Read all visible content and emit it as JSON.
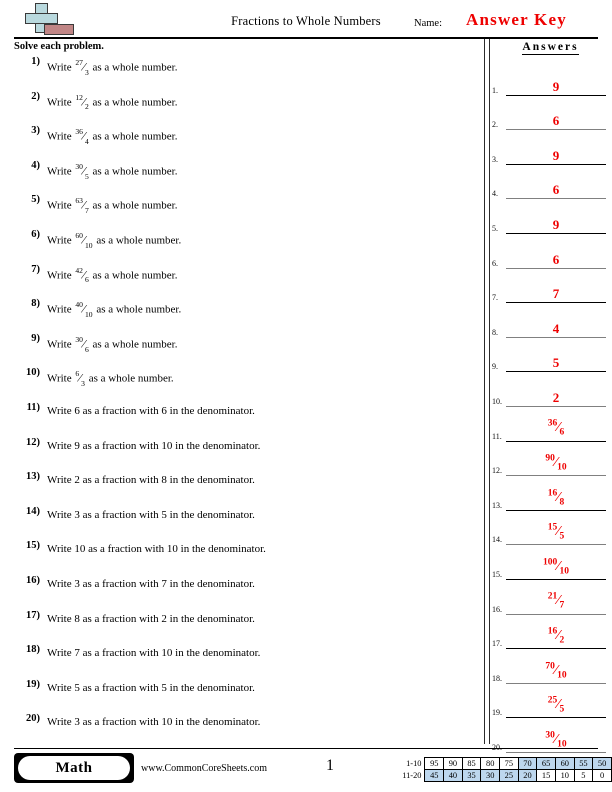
{
  "header": {
    "title": "Fractions to Whole Numbers",
    "name_label": "Name:",
    "answer_key": "Answer Key",
    "logo_icon": "plus-block-logo",
    "logo_plus_color": "#b9d9de",
    "logo_rect_color": "#c08585"
  },
  "instructions": "Solve each problem.",
  "answers_header": "Answers",
  "accent_color": "#ee0000",
  "highlight_color": "#bdd7ee",
  "problems": [
    {
      "num": "1)",
      "prefix": "Write",
      "fraction": {
        "numerator": "27",
        "denominator": "3"
      },
      "suffix": "as a whole number."
    },
    {
      "num": "2)",
      "prefix": "Write",
      "fraction": {
        "numerator": "12",
        "denominator": "2"
      },
      "suffix": "as a whole number."
    },
    {
      "num": "3)",
      "prefix": "Write",
      "fraction": {
        "numerator": "36",
        "denominator": "4"
      },
      "suffix": "as a whole number."
    },
    {
      "num": "4)",
      "prefix": "Write",
      "fraction": {
        "numerator": "30",
        "denominator": "5"
      },
      "suffix": "as a whole number."
    },
    {
      "num": "5)",
      "prefix": "Write",
      "fraction": {
        "numerator": "63",
        "denominator": "7"
      },
      "suffix": "as a whole number."
    },
    {
      "num": "6)",
      "prefix": "Write",
      "fraction": {
        "numerator": "60",
        "denominator": "10"
      },
      "suffix": "as a whole number."
    },
    {
      "num": "7)",
      "prefix": "Write",
      "fraction": {
        "numerator": "42",
        "denominator": "6"
      },
      "suffix": "as a whole number."
    },
    {
      "num": "8)",
      "prefix": "Write",
      "fraction": {
        "numerator": "40",
        "denominator": "10"
      },
      "suffix": "as a whole number."
    },
    {
      "num": "9)",
      "prefix": "Write",
      "fraction": {
        "numerator": "30",
        "denominator": "6"
      },
      "suffix": "as a whole number."
    },
    {
      "num": "10)",
      "prefix": "Write",
      "fraction": {
        "numerator": "6",
        "denominator": "3"
      },
      "suffix": "as a whole number."
    },
    {
      "num": "11)",
      "text": "Write 6 as a fraction with 6 in the denominator."
    },
    {
      "num": "12)",
      "text": "Write 9 as a fraction with 10 in the denominator."
    },
    {
      "num": "13)",
      "text": "Write 2 as a fraction with 8 in the denominator."
    },
    {
      "num": "14)",
      "text": "Write 3 as a fraction with 5 in the denominator."
    },
    {
      "num": "15)",
      "text": "Write 10 as a fraction with 10 in the denominator."
    },
    {
      "num": "16)",
      "text": "Write 3 as a fraction with 7 in the denominator."
    },
    {
      "num": "17)",
      "text": "Write 8 as a fraction with 2 in the denominator."
    },
    {
      "num": "18)",
      "text": "Write 7 as a fraction with 10 in the denominator."
    },
    {
      "num": "19)",
      "text": "Write 5 as a fraction with 5 in the denominator."
    },
    {
      "num": "20)",
      "text": "Write 3 as a fraction with 10 in the denominator."
    }
  ],
  "answers": [
    {
      "num": "1.",
      "value": "9"
    },
    {
      "num": "2.",
      "value": "6"
    },
    {
      "num": "3.",
      "value": "9"
    },
    {
      "num": "4.",
      "value": "6"
    },
    {
      "num": "5.",
      "value": "9"
    },
    {
      "num": "6.",
      "value": "6"
    },
    {
      "num": "7.",
      "value": "7"
    },
    {
      "num": "8.",
      "value": "4"
    },
    {
      "num": "9.",
      "value": "5"
    },
    {
      "num": "10.",
      "value": "2"
    },
    {
      "num": "11.",
      "fraction": {
        "numerator": "36",
        "denominator": "6"
      }
    },
    {
      "num": "12.",
      "fraction": {
        "numerator": "90",
        "denominator": "10"
      }
    },
    {
      "num": "13.",
      "fraction": {
        "numerator": "16",
        "denominator": "8"
      }
    },
    {
      "num": "14.",
      "fraction": {
        "numerator": "15",
        "denominator": "5"
      }
    },
    {
      "num": "15.",
      "fraction": {
        "numerator": "100",
        "denominator": "10"
      }
    },
    {
      "num": "16.",
      "fraction": {
        "numerator": "21",
        "denominator": "7"
      }
    },
    {
      "num": "17.",
      "fraction": {
        "numerator": "16",
        "denominator": "2"
      }
    },
    {
      "num": "18.",
      "fraction": {
        "numerator": "70",
        "denominator": "10"
      }
    },
    {
      "num": "19.",
      "fraction": {
        "numerator": "25",
        "denominator": "5"
      }
    },
    {
      "num": "20.",
      "fraction": {
        "numerator": "30",
        "denominator": "10"
      }
    }
  ],
  "footer": {
    "subject_badge": "Math",
    "website": "www.CommonCoreSheets.com",
    "page_number": "1"
  },
  "score_table": {
    "rows": [
      {
        "label": "1-10",
        "cells": [
          {
            "value": "95",
            "highlighted": false
          },
          {
            "value": "90",
            "highlighted": false
          },
          {
            "value": "85",
            "highlighted": false
          },
          {
            "value": "80",
            "highlighted": false
          },
          {
            "value": "75",
            "highlighted": false
          },
          {
            "value": "70",
            "highlighted": true
          },
          {
            "value": "65",
            "highlighted": true
          },
          {
            "value": "60",
            "highlighted": true
          },
          {
            "value": "55",
            "highlighted": true
          },
          {
            "value": "50",
            "highlighted": true
          }
        ]
      },
      {
        "label": "11-20",
        "cells": [
          {
            "value": "45",
            "highlighted": true
          },
          {
            "value": "40",
            "highlighted": true
          },
          {
            "value": "35",
            "highlighted": true
          },
          {
            "value": "30",
            "highlighted": true
          },
          {
            "value": "25",
            "highlighted": true
          },
          {
            "value": "20",
            "highlighted": true
          },
          {
            "value": "15",
            "highlighted": false
          },
          {
            "value": "10",
            "highlighted": false
          },
          {
            "value": "5",
            "highlighted": false
          },
          {
            "value": "0",
            "highlighted": false
          }
        ]
      }
    ]
  }
}
